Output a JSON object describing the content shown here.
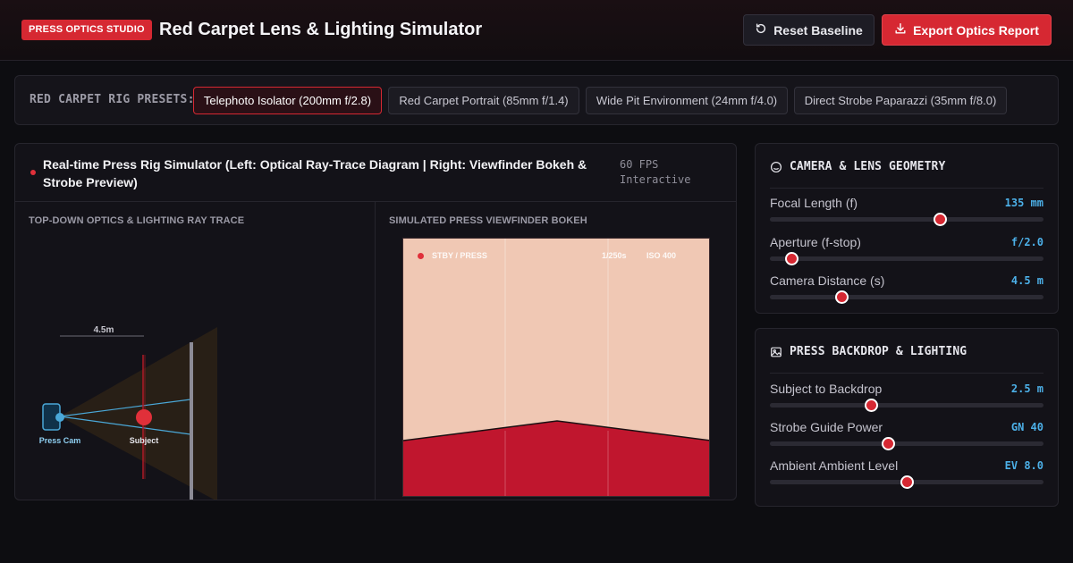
{
  "header": {
    "brand": "PRESS OPTICS STUDIO",
    "title": "Red Carpet Lens & Lighting Simulator",
    "reset_label": "Reset Baseline",
    "export_label": "Export Optics Report"
  },
  "presets": {
    "label": "RED CARPET RIG PRESETS:",
    "items": [
      {
        "label": "Telephoto Isolator (200mm f/2.8)",
        "active": true
      },
      {
        "label": "Red Carpet Portrait (85mm f/1.4)",
        "active": false
      },
      {
        "label": "Wide Pit Environment (24mm f/4.0)",
        "active": false
      },
      {
        "label": "Direct Strobe Paparazzi (35mm f/8.0)",
        "active": false
      }
    ]
  },
  "simulator": {
    "title": "Real-time Press Rig Simulator (Left: Optical Ray-Trace Diagram | Right: Viewfinder Bokeh & Strobe Preview)",
    "fps": "60 FPS",
    "mode": "Interactive",
    "ray_pane": {
      "label": "TOP-DOWN OPTICS & LIGHTING RAY TRACE",
      "distance_label": "4.5m",
      "camera_label": "Press Cam",
      "subject_label": "Subject"
    },
    "viewfinder": {
      "label": "SIMULATED PRESS VIEWFINDER BOKEH",
      "status": "STBY / PRESS",
      "shutter": "1/250s",
      "iso": "ISO 400"
    }
  },
  "camera_card": {
    "title": "CAMERA & LENS GEOMETRY",
    "controls": [
      {
        "label": "Focal Length (f)",
        "value": "135 mm",
        "fraction": 0.62
      },
      {
        "label": "Aperture (f-stop)",
        "value": "f/2.0",
        "fraction": 0.08
      },
      {
        "label": "Camera Distance (s)",
        "value": "4.5 m",
        "fraction": 0.26
      }
    ]
  },
  "lighting_card": {
    "title": "PRESS BACKDROP & LIGHTING",
    "controls": [
      {
        "label": "Subject to Backdrop",
        "value": "2.5 m",
        "fraction": 0.37
      },
      {
        "label": "Strobe Guide Power",
        "value": "GN 40",
        "fraction": 0.43
      },
      {
        "label": "Ambient Ambient Level",
        "value": "EV 8.0",
        "fraction": 0.5
      }
    ]
  },
  "colors": {
    "accent": "#d62832",
    "value_blue": "#4cb0e8",
    "backdrop_skin": "#f0c8b4",
    "carpet_red": "#c0162e"
  }
}
